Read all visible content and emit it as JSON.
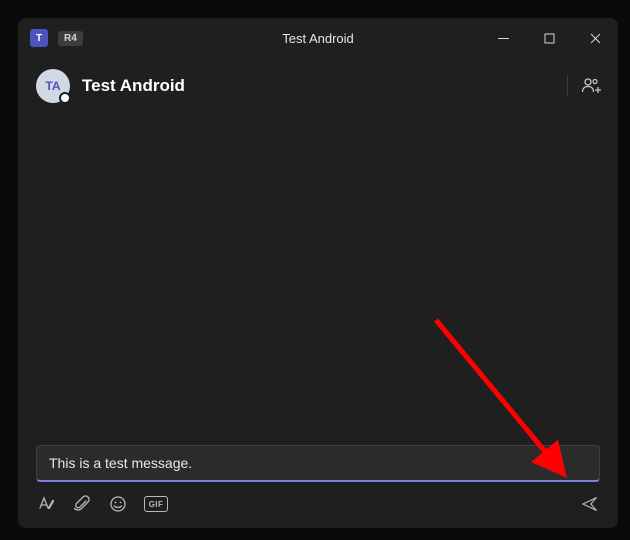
{
  "titlebar": {
    "app_glyph": "T",
    "badge": "R4",
    "title": "Test Android"
  },
  "chat_header": {
    "avatar_initials": "TA",
    "name": "Test Android"
  },
  "compose": {
    "value": "This is a test message."
  },
  "toolbar": {
    "gif_label": "GIF"
  }
}
